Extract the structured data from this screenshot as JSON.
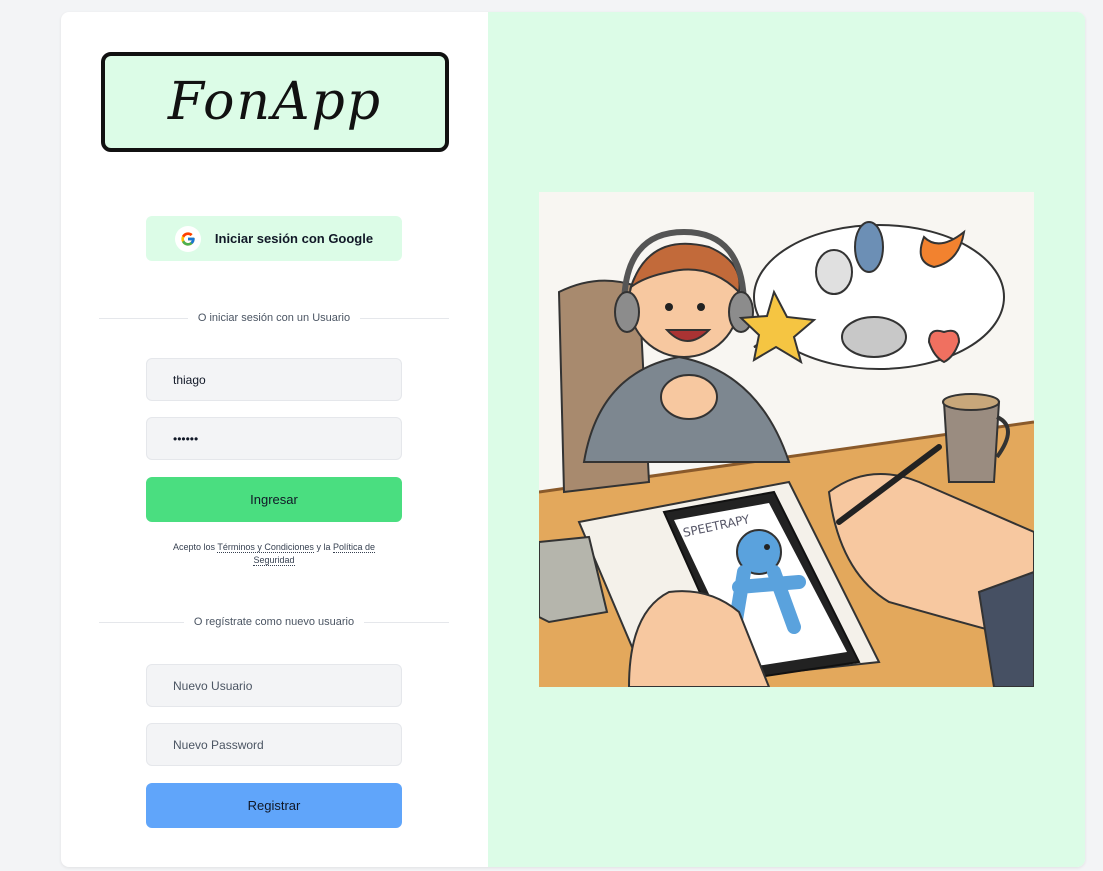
{
  "logo": {
    "text": "FonApp"
  },
  "google": {
    "label": "Iniciar sesión con Google",
    "icon": "google-icon"
  },
  "login": {
    "divider": "O iniciar sesión con un Usuario",
    "username_value": "thiago",
    "password_value": "••••••",
    "submit_label": "Ingresar"
  },
  "terms": {
    "prefix": "Acepto los",
    "terms_link": "Términos y Condiciones",
    "middle": "y la",
    "privacy_link": "Política de Seguridad"
  },
  "register": {
    "divider": "O regístrate como nuevo usuario",
    "username_placeholder": "Nuevo Usuario",
    "password_placeholder": "Nuevo Password",
    "submit_label": "Registrar"
  },
  "illustration": {
    "clipboard_text": "SPEETRAPY"
  },
  "colors": {
    "accent_light": "#dcfce7",
    "green_button": "#4ade80",
    "blue_button": "#60a5fa",
    "page_bg": "#f3f4f6"
  }
}
